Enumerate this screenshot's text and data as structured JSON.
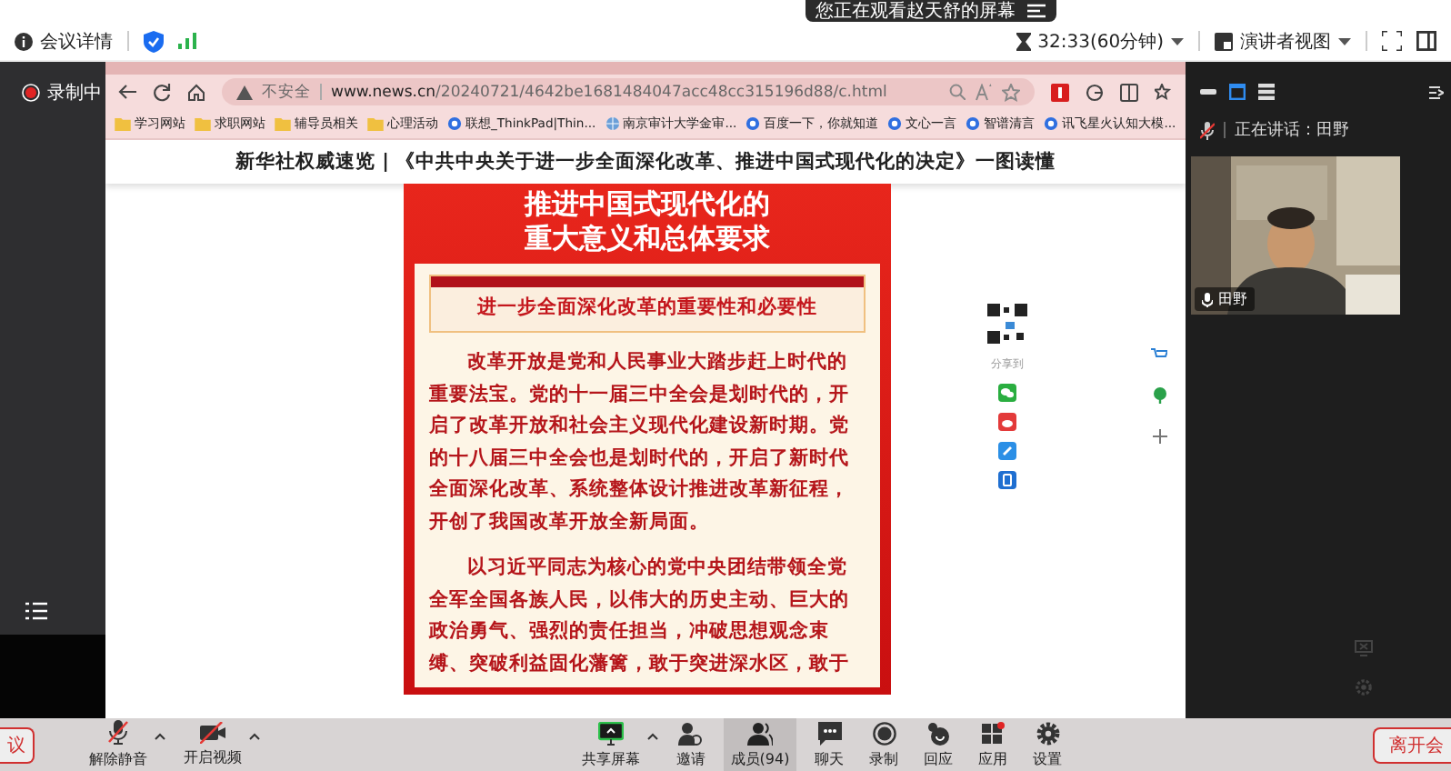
{
  "share_banner": {
    "text": "您正在观看赵天舒的屏幕"
  },
  "header": {
    "meeting_info": "会议详情",
    "timer": "32:33(60分钟)",
    "view_mode": "演讲者视图"
  },
  "sidebar": {
    "recording": "录制中"
  },
  "browser": {
    "security": "不安全",
    "url_domain": "www.news.cn",
    "url_path": "/20240721/4642be1681484047acc48cc315196d88/c.html",
    "bookmarks": [
      {
        "label": "学习网站",
        "kind": "folder"
      },
      {
        "label": "求职网站",
        "kind": "folder"
      },
      {
        "label": "辅导员相关",
        "kind": "folder"
      },
      {
        "label": "心理活动",
        "kind": "folder"
      },
      {
        "label": "联想_ThinkPad|Thin...",
        "kind": "site"
      },
      {
        "label": "南京审计大学金审...",
        "kind": "globe"
      },
      {
        "label": "百度一下，你就知道",
        "kind": "site"
      },
      {
        "label": "文心一言",
        "kind": "site"
      },
      {
        "label": "智谱清言",
        "kind": "site"
      },
      {
        "label": "讯飞星火认知大模...",
        "kind": "site"
      }
    ],
    "page": {
      "headline": "新华社权威速览 | 《中共中央关于进一步全面深化改革、推进中国式现代化的决定》一图读懂",
      "poster": {
        "title_lines": [
          "推进中国式现代化的",
          "重大意义和总体要求"
        ],
        "section": "进一步全面深化改革的重要性和必要性",
        "paragraphs": [
          "改革开放是党和人民事业大踏步赶上时代的重要法宝。党的十一届三中全会是划时代的，开启了改革开放和社会主义现代化建设新时期。党的十八届三中全会也是划时代的，开启了新时代全面深化改革、系统整体设计推进改革新征程，开创了我国改革开放全新局面。",
          "以习近平同志为核心的党中央团结带领全党全军全国各族人民，以伟大的历史主动、巨大的政治勇气、强烈的责任担当，冲破思想观念束缚、突破利益固化藩篱，敢于突进深水区，敢于"
        ]
      },
      "share_label": "分享到"
    }
  },
  "speaker_panel": {
    "speaking_label": "正在讲话：",
    "speaker": "田野",
    "video_name": "田野",
    "mic_muted": true
  },
  "toolbar": {
    "end_button": "议",
    "left_buttons": [
      {
        "label": "解除静音",
        "kind": "mic"
      },
      {
        "label": "开启视频",
        "kind": "camera"
      }
    ],
    "center_buttons": [
      {
        "label": "共享屏幕",
        "kind": "share",
        "selected": false
      },
      {
        "label": "邀请",
        "kind": "invite",
        "selected": false
      },
      {
        "label": "成员(94)",
        "kind": "members",
        "selected": true
      },
      {
        "label": "聊天",
        "kind": "chat",
        "selected": false
      },
      {
        "label": "录制",
        "kind": "record",
        "selected": false
      },
      {
        "label": "回应",
        "kind": "react",
        "selected": false
      },
      {
        "label": "应用",
        "kind": "apps",
        "selected": false
      },
      {
        "label": "设置",
        "kind": "settings",
        "selected": false
      }
    ],
    "leave_button": "离开会"
  }
}
